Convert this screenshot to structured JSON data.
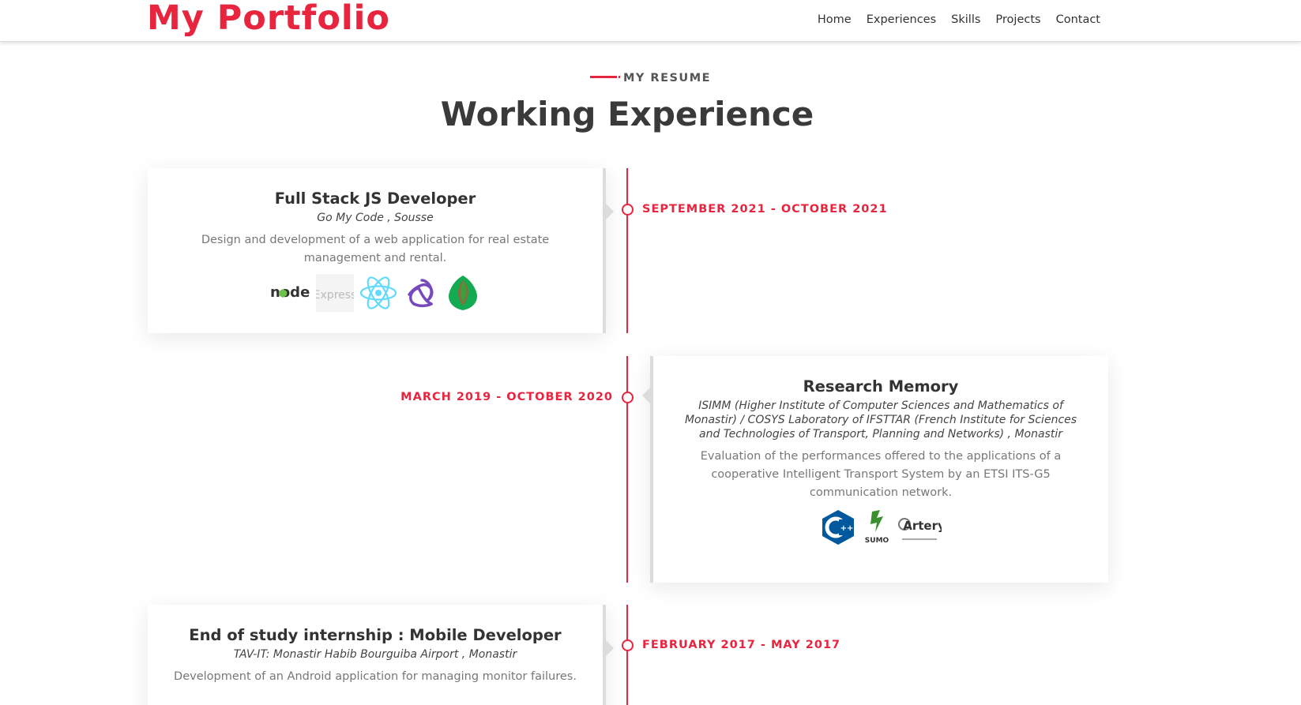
{
  "header": {
    "brand": "My Portfolio",
    "nav": [
      "Home",
      "Experiences",
      "Skills",
      "Projects",
      "Contact"
    ]
  },
  "section": {
    "eyebrow": "MY RESUME",
    "title": "Working Experience"
  },
  "colors": {
    "accent": "#e8253f",
    "text": "#333333"
  },
  "experiences": [
    {
      "date": "SEPTEMBER 2021 - OCTOBER 2021",
      "title": "Full Stack JS Developer",
      "company": "Go My Code , Sousse",
      "description": "Design and development of a web application for real estate management and rental.",
      "tech_icons": [
        "nodejs-logo",
        "express-logo",
        "react-logo",
        "redux-logo",
        "mongodb-logo"
      ],
      "tech_text": {
        "node": "node",
        "express": "Express"
      }
    },
    {
      "date": "MARCH 2019 - OCTOBER 2020",
      "title": "Research Memory",
      "company": "ISIMM (Higher Institute of Computer Sciences and Mathematics of Monastir) / COSYS Laboratory of IFSTTAR (French Institute for Sciences and Technologies of Transport, Planning and Networks) , Monastir",
      "description": "Evaluation of the performances offered to the applications of a cooperative Intelligent Transport System by an ETSI ITS-G5 communication network.",
      "tech_icons": [
        "cpp-logo",
        "sumo-logo",
        "artery-logo"
      ],
      "tech_text": {
        "sumo": "SUMO",
        "artery": "Artery"
      }
    },
    {
      "date": "FEBRUARY 2017 - MAY 2017",
      "title": "End of study internship : Mobile Developer",
      "company": "TAV-IT: Monastir Habib Bourguiba Airport , Monastir",
      "description": "Development of an Android application for managing monitor failures."
    }
  ]
}
